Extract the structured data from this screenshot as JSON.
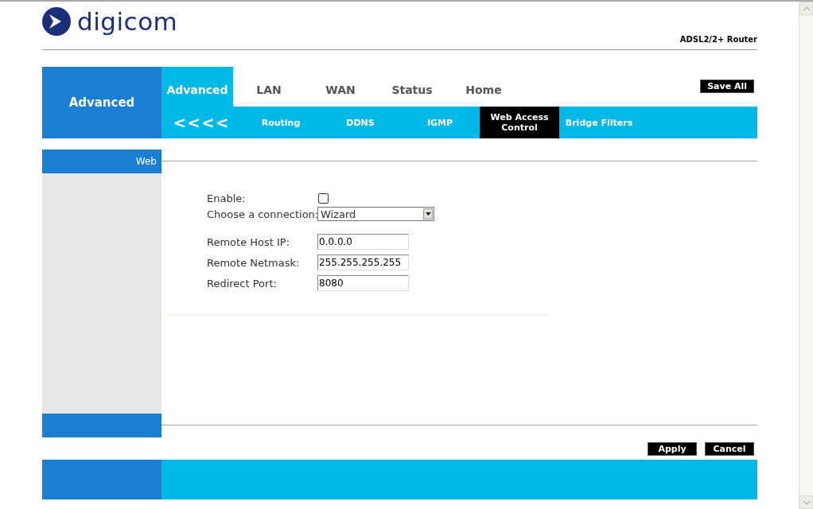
{
  "logo": {
    "text": "digicom"
  },
  "product": "ADSL2/2+ Router",
  "section_title": "Advanced",
  "tabs": [
    {
      "label": "Advanced",
      "selected": true
    },
    {
      "label": "LAN",
      "selected": false
    },
    {
      "label": "WAN",
      "selected": false
    },
    {
      "label": "Status",
      "selected": false
    },
    {
      "label": "Home",
      "selected": false
    }
  ],
  "save_all": "Save All",
  "subtabs": [
    {
      "label": "<<<<",
      "kind": "back",
      "selected": false
    },
    {
      "label": "Routing",
      "kind": "page",
      "selected": false
    },
    {
      "label": "DDNS",
      "kind": "page",
      "selected": false
    },
    {
      "label": "IGMP",
      "kind": "page",
      "selected": false
    },
    {
      "label": "Web Access Control",
      "kind": "page",
      "selected": true
    },
    {
      "label": "Bridge Filters",
      "kind": "page",
      "selected": false
    }
  ],
  "sidebar_title": "Web",
  "fields": [
    {
      "kind": "checkbox",
      "label": "Enable:",
      "checked": false
    },
    {
      "kind": "select",
      "label": "Choose a connection:",
      "value": "Wizard"
    },
    {
      "kind": "text",
      "label": "Remote Host IP:",
      "value": "0.0.0.0"
    },
    {
      "kind": "text",
      "label": "Remote Netmask:",
      "value": "255.255.255.255"
    },
    {
      "kind": "text",
      "label": "Redirect Port:",
      "value": "8080"
    }
  ],
  "buttons": [
    "Apply",
    "Cancel"
  ]
}
